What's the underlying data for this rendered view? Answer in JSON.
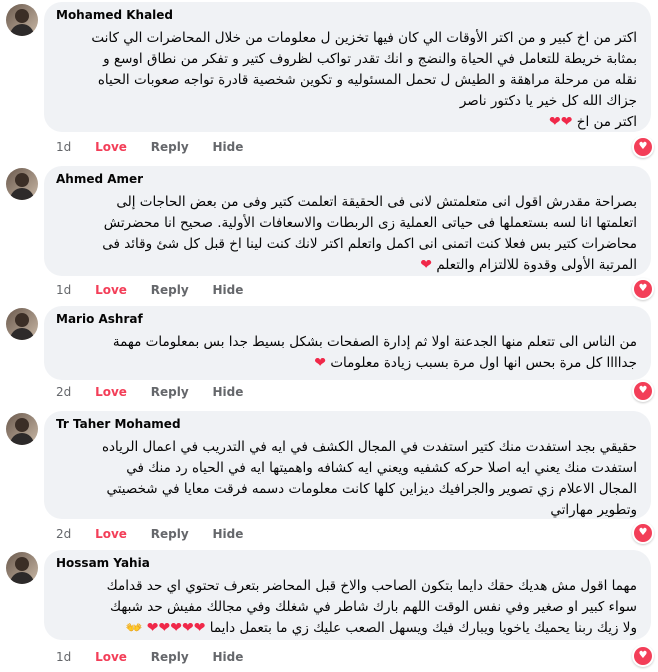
{
  "comments": [
    {
      "name": "Mohamed Khaled",
      "lines": [
        "اكتر من اخ كبير و من اكتر الأوقات الي كان فيها تخزين ل معلومات من خلال المحاضرات الي كانت",
        "بمثابة خريطة للتعامل في الحياة والنضج و انك تقدر تواكب لظروف كتير و تفكر من نطاق اوسع و",
        "نقله من مرحلة مراهقة و الطيش ل تحمل المسئوليه و تكوين شخصية قادرة تواجه صعوبات الحياه",
        "جزاك الله كل خير يا دكتور ناصر",
        "اكتر من اخ ❤❤"
      ],
      "time": "1d",
      "love": "Love",
      "reply": "Reply",
      "hide": "Hide"
    },
    {
      "name": "Ahmed Amer",
      "lines": [
        "بصراحة مقدرش اقول انى متعلمتش لانى فى الحقيقة اتعلمت كتير وفى من بعض الحاجات إلى",
        "اتعلمتها انا لسه بستعملها فى حياتى العملية زى الربطات والاسعافات الأولية. صحيح انا محضرتش",
        "محاضرات كتير بس فعلا كنت اتمنى انى اكمل واتعلم اكتر لانك كنت لينا اخ قبل كل شئ وقائد فى",
        "المرتبة الأولى وقدوة للالتزام والتعلم ❤"
      ],
      "time": "1d",
      "love": "Love",
      "reply": "Reply",
      "hide": "Hide"
    },
    {
      "name": "Mario Ashraf",
      "lines": [
        "من الناس الى تتعلم منها الجدعنة اولا ثم إدارة الصفحات بشكل بسيط جدا بس بمعلومات مهمة",
        "جداااا كل مرة بحس انها اول مرة بسبب زيادة معلومات ❤"
      ],
      "time": "2d",
      "love": "Love",
      "reply": "Reply",
      "hide": "Hide"
    },
    {
      "name": "Tr Taher Mohamed",
      "lines": [
        "حقيقي بجد استفدت منك كتير استفدت في المجال الكشف في ايه في التدريب في اعمال الرياده",
        "استفدت منك يعني ايه اصلا حركه كشفيه ويعني ايه كشافه واهميتها ايه في الحياه رد منك في",
        "المجال الاعلام زي تصوير والجرافيك ديزاين كلها كانت معلومات دسمه فرقت معايا في شخصيتي",
        "وتطوير مهاراتي"
      ],
      "time": "2d",
      "love": "Love",
      "reply": "Reply",
      "hide": "Hide"
    },
    {
      "name": "Hossam Yahia",
      "lines": [
        "مهما اقول مش هديك حقك دايما بتكون الصاحب والاخ قبل المحاضر بتعرف تحتوي اي حد قدامك",
        "سواء كبير او صغير وفي نفس الوقت اللهم بارك شاطر في شغلك وفي مجالك مفيش حد شبهك",
        "ولا زيك ربنا يحميك ياخويا ويبارك فيك ويسهل الصعب عليك زي ما بتعمل دايما ❤❤❤❤❤ 👐"
      ],
      "time": "1d",
      "love": "Love",
      "reply": "Reply",
      "hide": "Hide"
    }
  ],
  "colors": {
    "bubble": "#f0f2f5",
    "love": "#f33e58",
    "muted": "#65676b"
  },
  "icons": {
    "reaction": "heart-reaction-icon",
    "avatar": "avatar"
  }
}
